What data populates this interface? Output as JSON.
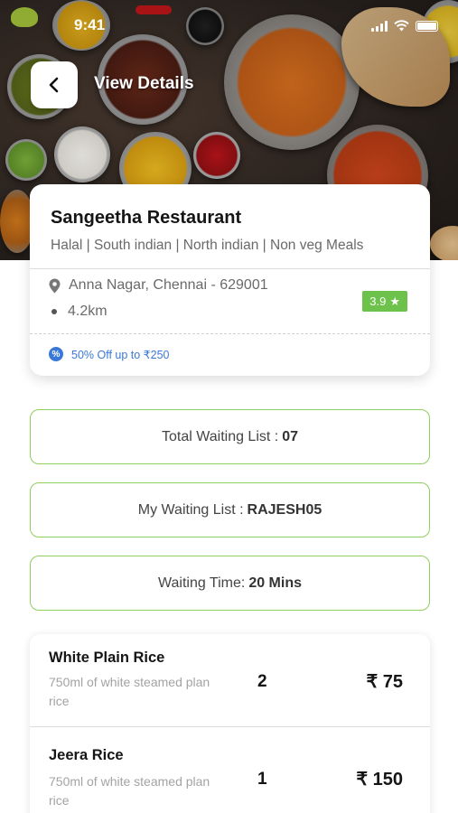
{
  "status_bar": {
    "time": "9:41"
  },
  "header": {
    "title": "View Details",
    "back_icon": "chevron-left-icon"
  },
  "restaurant": {
    "name": "Sangeetha Restaurant",
    "cuisines": "Halal | South indian | North indian | Non veg Meals",
    "location": "Anna Nagar, Chennai - 629001",
    "distance": "4.2km",
    "rating": "3.9",
    "rating_star": "★",
    "offer": "50% Off up to ₹250",
    "offer_icon_glyph": "%"
  },
  "waiting": {
    "total_label": "Total Waiting List :",
    "total_value": "07",
    "mine_label": "My Waiting List :",
    "mine_value": "RAJESH05",
    "time_label": "Waiting Time:",
    "time_value": "20 Mins"
  },
  "items": [
    {
      "name": "White Plain Rice",
      "desc": "750ml of white steamed plan rice",
      "qty": "2",
      "price": "₹ 75"
    },
    {
      "name": "Jeera Rice",
      "desc": "750ml of white steamed plan rice",
      "qty": "1",
      "price": "₹ 150"
    }
  ],
  "colors": {
    "accent_green": "#8fce5f",
    "rating_green": "#6cc24a",
    "offer_blue": "#3a78d8"
  }
}
